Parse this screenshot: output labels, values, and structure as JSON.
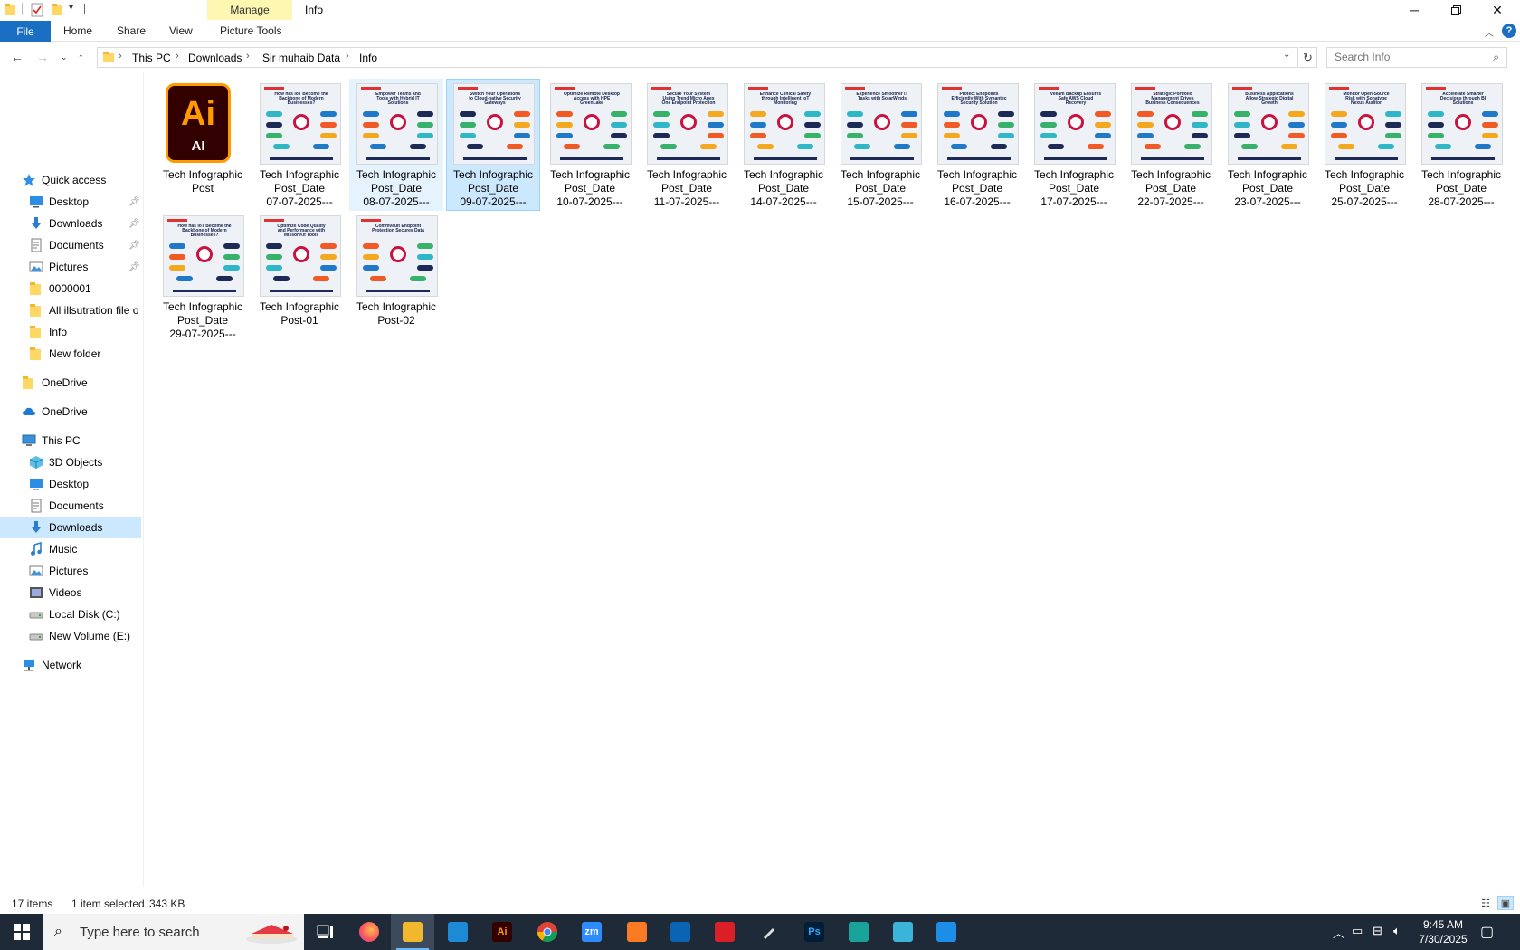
{
  "window": {
    "title": "Info",
    "qat_icons": [
      "folder-icon",
      "properties-icon",
      "new-folder-icon",
      "customize-qat-icon"
    ]
  },
  "ribbon": {
    "contextual_group": "Manage",
    "tabs": [
      "File",
      "Home",
      "Share",
      "View",
      "Picture Tools"
    ]
  },
  "address": {
    "crumbs": [
      "This PC",
      "Downloads",
      "Sir muhaib Data",
      "Info"
    ]
  },
  "search": {
    "placeholder": "Search Info"
  },
  "nav_pane": {
    "items": [
      {
        "label": "Quick access",
        "icon": "star-icon",
        "indent": 1,
        "pinned": false
      },
      {
        "label": "Desktop",
        "icon": "desktop-icon",
        "indent": 2,
        "pinned": true
      },
      {
        "label": "Downloads",
        "icon": "download-icon",
        "indent": 2,
        "pinned": true
      },
      {
        "label": "Documents",
        "icon": "documents-icon",
        "indent": 2,
        "pinned": true
      },
      {
        "label": "Pictures",
        "icon": "pictures-icon",
        "indent": 2,
        "pinned": true
      },
      {
        "label": "0000001",
        "icon": "folder-icon",
        "indent": 2,
        "pinned": false
      },
      {
        "label": "All illsutration file o",
        "icon": "folder-icon",
        "indent": 2,
        "pinned": false
      },
      {
        "label": "Info",
        "icon": "folder-icon",
        "indent": 2,
        "pinned": false
      },
      {
        "label": "New folder",
        "icon": "folder-icon",
        "indent": 2,
        "pinned": false
      },
      {
        "label": "OneDrive",
        "icon": "folder-icon",
        "indent": 1,
        "pinned": false
      },
      {
        "label": "OneDrive",
        "icon": "cloud-icon",
        "indent": 1,
        "pinned": false
      },
      {
        "label": "This PC",
        "icon": "computer-icon",
        "indent": 1,
        "pinned": false
      },
      {
        "label": "3D Objects",
        "icon": "cube-icon",
        "indent": 2,
        "pinned": false
      },
      {
        "label": "Desktop",
        "icon": "desktop-icon",
        "indent": 2,
        "pinned": false
      },
      {
        "label": "Documents",
        "icon": "documents-icon",
        "indent": 2,
        "pinned": false
      },
      {
        "label": "Downloads",
        "icon": "download-icon",
        "indent": 2,
        "pinned": false,
        "selected": true
      },
      {
        "label": "Music",
        "icon": "music-icon",
        "indent": 2,
        "pinned": false
      },
      {
        "label": "Pictures",
        "icon": "pictures-icon",
        "indent": 2,
        "pinned": false
      },
      {
        "label": "Videos",
        "icon": "videos-icon",
        "indent": 2,
        "pinned": false
      },
      {
        "label": "Local Disk (C:)",
        "icon": "drive-icon",
        "indent": 2,
        "pinned": false
      },
      {
        "label": "New Volume (E:)",
        "icon": "drive-icon",
        "indent": 2,
        "pinned": false
      },
      {
        "label": "Network",
        "icon": "network-icon",
        "indent": 1,
        "pinned": false
      }
    ]
  },
  "files": [
    {
      "lines": [
        "Tech Infographic",
        "Post"
      ],
      "kind": "ai",
      "thumb_title": ""
    },
    {
      "lines": [
        "Tech Infographic",
        "Post_Date",
        "07-07-2025---"
      ],
      "kind": "png",
      "thumb_title": "How has IoT Become the Backbone of Modern Businesses?"
    },
    {
      "lines": [
        "Tech Infographic",
        "Post_Date",
        "08-07-2025---"
      ],
      "kind": "png",
      "thumb_title": "Empower Teams and Tools with Hybrid IT Solutions",
      "state": "hover"
    },
    {
      "lines": [
        "Tech Infographic",
        "Post_Date",
        "09-07-2025---"
      ],
      "kind": "png",
      "thumb_title": "Switch Your Operations to Cloud-native Security Gateways",
      "state": "selected"
    },
    {
      "lines": [
        "Tech Infographic",
        "Post_Date",
        "10-07-2025---"
      ],
      "kind": "png",
      "thumb_title": "Optimize Remote Desktop Access with HPE GreenLake"
    },
    {
      "lines": [
        "Tech Infographic",
        "Post_Date",
        "11-07-2025---"
      ],
      "kind": "png",
      "thumb_title": "Secure Your System Using Trend Micro Apex One Endpoint Protection"
    },
    {
      "lines": [
        "Tech Infographic",
        "Post_Date",
        "14-07-2025---"
      ],
      "kind": "png",
      "thumb_title": "Enhance Clinical Safety through Intelligent IoT Monitoring"
    },
    {
      "lines": [
        "Tech Infographic",
        "Post_Date",
        "15-07-2025---"
      ],
      "kind": "png",
      "thumb_title": "Experience Smoother IT Tasks with SolarWinds"
    },
    {
      "lines": [
        "Tech Infographic",
        "Post_Date",
        "16-07-2025---"
      ],
      "kind": "png",
      "thumb_title": "Protect Endpoints Efficiently With Symantec Security Solution"
    },
    {
      "lines": [
        "Tech Infographic",
        "Post_Date",
        "17-07-2025---"
      ],
      "kind": "png",
      "thumb_title": "Veeam Backup Ensures Safe AWS Cloud Recovery"
    },
    {
      "lines": [
        "Tech Infographic",
        "Post_Date",
        "22-07-2025---"
      ],
      "kind": "png",
      "thumb_title": "Strategic Portfolio Management Drives Business Consequences"
    },
    {
      "lines": [
        "Tech Infographic",
        "Post_Date",
        "23-07-2025---"
      ],
      "kind": "png",
      "thumb_title": "Business Applications Allow Strategic Digital Growth"
    },
    {
      "lines": [
        "Tech Infographic",
        "Post_Date",
        "25-07-2025---"
      ],
      "kind": "png",
      "thumb_title": "Monitor Open-Source Risk with Sonatype Nexus Auditor"
    },
    {
      "lines": [
        "Tech Infographic",
        "Post_Date",
        "28-07-2025---"
      ],
      "kind": "png",
      "thumb_title": "Accelerate Smarter Decisions through BI Solutions"
    },
    {
      "lines": [
        "Tech Infographic",
        "Post_Date",
        "29-07-2025---"
      ],
      "kind": "png",
      "thumb_title": "How has IoT Become the Backbone of Modern Businesses?"
    },
    {
      "lines": [
        "Tech Infographic",
        "Post-01"
      ],
      "kind": "png",
      "thumb_title": "Optimize Code Quality and Performance with MissonKit Tools"
    },
    {
      "lines": [
        "Tech Infographic",
        "Post-02"
      ],
      "kind": "png",
      "thumb_title": "Commvault Endpoint Protection Secures Data"
    }
  ],
  "status": {
    "item_count": "17 items",
    "selection": "1 item selected",
    "size": "343 KB"
  },
  "taskbar": {
    "search_placeholder": "Type here to search",
    "apps": [
      {
        "name": "task-view",
        "label": "",
        "color": "#1f2a38",
        "icon": "task-view-icon"
      },
      {
        "name": "firefox",
        "label": "",
        "color": "#ff7139",
        "icon": "firefox-icon"
      },
      {
        "name": "file-explorer",
        "label": "",
        "color": "#f1b82d",
        "icon": "folder-icon",
        "active": true
      },
      {
        "name": "vscode",
        "label": "",
        "color": "#1e8ad6",
        "icon": "vscode-icon"
      },
      {
        "name": "illustrator",
        "label": "Ai",
        "color": "#330000",
        "icon": "illustrator-icon"
      },
      {
        "name": "chrome",
        "label": "",
        "color": "#db4437",
        "icon": "chrome-icon"
      },
      {
        "name": "zoom",
        "label": "zm",
        "color": "#2d8cff",
        "icon": "zoom-icon"
      },
      {
        "name": "xampp",
        "label": "",
        "color": "#fb7a24",
        "icon": "xampp-icon"
      },
      {
        "name": "outlook",
        "label": "",
        "color": "#0a64b4",
        "icon": "outlook-icon"
      },
      {
        "name": "creative-cloud",
        "label": "",
        "color": "#da1f26",
        "icon": "creative-cloud-icon"
      },
      {
        "name": "pen-tool",
        "label": "",
        "color": "#1f2a38",
        "icon": "pen-icon"
      },
      {
        "name": "photoshop",
        "label": "Ps",
        "color": "#001e36",
        "icon": "photoshop-icon"
      },
      {
        "name": "app-teal",
        "label": "",
        "color": "#1aa39a",
        "icon": "diamond-icon"
      },
      {
        "name": "app-notes",
        "label": "",
        "color": "#3ab5d9",
        "icon": "notes-icon"
      },
      {
        "name": "app-blue",
        "label": "",
        "color": "#1d8ee8",
        "icon": "paint-icon"
      }
    ],
    "time": "9:45 AM",
    "date": "7/30/2025"
  }
}
